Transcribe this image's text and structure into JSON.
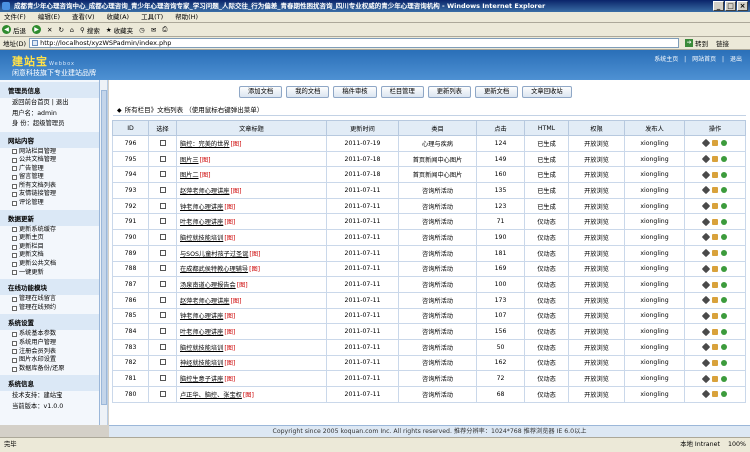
{
  "window": {
    "title": "成都青少年心理咨询中心_成都心理咨询_青少年心理咨询专家_学习问题_人际交往_行为偏差_青春期性困扰咨询_四川专业权威的青少年心理咨询机构 - Windows Internet Explorer"
  },
  "menu": [
    "文件(F)",
    "编辑(E)",
    "查看(V)",
    "收藏(A)",
    "工具(T)",
    "帮助(H)"
  ],
  "toolbar": {
    "back": "后退",
    "search": "搜索",
    "favorites": "收藏夹"
  },
  "address": {
    "label": "地址(D)",
    "url": "http://localhost/xyzWSPadmin/index.php",
    "go": "转到",
    "links": "链接"
  },
  "header": {
    "logo": "建站宝",
    "logo_sub": "Webbox",
    "slogan": "闲意科技旗下专业建站品牌",
    "links": [
      "系统主页",
      "|",
      "网站首页",
      "|",
      "退出"
    ]
  },
  "sidebar": {
    "sections": [
      {
        "title": "管理员信息",
        "text": [
          "返回前台首页 | 退出",
          "用户名：admin",
          "身  份：超级管理员"
        ]
      },
      {
        "title": "网站内容",
        "items": [
          "网站栏目管理",
          "公共文档管理",
          "广告管理",
          "留言管理",
          "所有文档列表",
          "友情链接管理",
          "评论管理"
        ]
      },
      {
        "title": "数据更新",
        "items": [
          "更新系统缓存",
          "更新主页",
          "更新栏目",
          "更新文档",
          "更新公共文档",
          "一键更新"
        ]
      },
      {
        "title": "在线功能模块",
        "items": [
          "管理在线留言",
          "管理在线预约"
        ]
      },
      {
        "title": "系统设置",
        "items": [
          "系统基本参数",
          "系统用户管理",
          "注册会员列表",
          "图片水印设置",
          "数据库备份/还原"
        ]
      },
      {
        "title": "系统信息",
        "text": [
          "技术支持：建站宝",
          "当前版本：v1.0.0"
        ]
      }
    ]
  },
  "tabs": [
    "添加文档",
    "我的文档",
    "稿件审核",
    "栏目管理",
    "更新列表",
    "更新文档",
    "文章回收站"
  ],
  "crumb": "所有栏目》文档列表  （使用鼠标右键弹出菜单）",
  "table": {
    "headers": [
      "ID",
      "选择",
      "文章标题",
      "更新时间",
      "类目",
      "点击",
      "HTML",
      "权限",
      "发布人",
      "操作"
    ],
    "rows": [
      {
        "id": "796",
        "title": "脑控：完美的世界",
        "tag": "[图]",
        "date": "2011-07-19",
        "cat": "心理与疾病",
        "clicks": "124",
        "html": "已生成",
        "perm": "开放浏览",
        "author": "xiongling"
      },
      {
        "id": "795",
        "title": "图片三",
        "tag": "[图]",
        "date": "2011-07-18",
        "cat": "首页新闻中心图片",
        "clicks": "149",
        "html": "已生成",
        "perm": "开放浏览",
        "author": "xiongling"
      },
      {
        "id": "794",
        "title": "图片二",
        "tag": "[图]",
        "date": "2011-07-18",
        "cat": "首页新闻中心图片",
        "clicks": "160",
        "html": "已生成",
        "perm": "开放浏览",
        "author": "xiongling"
      },
      {
        "id": "793",
        "title": "赵萍老师心理讲座",
        "tag": "[图]",
        "date": "2011-07-11",
        "cat": "咨询所活动",
        "clicks": "135",
        "html": "已生成",
        "perm": "开放浏览",
        "author": "xiongling"
      },
      {
        "id": "792",
        "title": "钟老师心理讲座",
        "tag": "[图]",
        "date": "2011-07-11",
        "cat": "咨询所活动",
        "clicks": "123",
        "html": "已生成",
        "perm": "开放浏览",
        "author": "xiongling"
      },
      {
        "id": "791",
        "title": "叶老师心理讲座",
        "tag": "[图]",
        "date": "2011-07-11",
        "cat": "咨询所活动",
        "clicks": "71",
        "html": "仅动态",
        "perm": "开放浏览",
        "author": "xiongling"
      },
      {
        "id": "790",
        "title": "脑控就技能培训",
        "tag": "[图]",
        "date": "2011-07-11",
        "cat": "咨询所活动",
        "clicks": "190",
        "html": "仅动态",
        "perm": "开放浏览",
        "author": "xiongling"
      },
      {
        "id": "789",
        "title": "与SOS儿童村孩子过圣诞",
        "tag": "[图]",
        "date": "2011-07-11",
        "cat": "咨询所活动",
        "clicks": "181",
        "html": "仅动态",
        "perm": "开放浏览",
        "author": "xiongling"
      },
      {
        "id": "788",
        "title": "在成都武侯特教心理辅导",
        "tag": "[图]",
        "date": "2011-07-11",
        "cat": "咨询所活动",
        "clicks": "169",
        "html": "仅动态",
        "perm": "开放浏览",
        "author": "xiongling"
      },
      {
        "id": "787",
        "title": "汤泉南道心理报告会",
        "tag": "[图]",
        "date": "2011-07-11",
        "cat": "咨询所活动",
        "clicks": "100",
        "html": "仅动态",
        "perm": "开放浏览",
        "author": "xiongling"
      },
      {
        "id": "786",
        "title": "赵萍老师心理讲座",
        "tag": "[图]",
        "date": "2011-07-11",
        "cat": "咨询所活动",
        "clicks": "173",
        "html": "仅动态",
        "perm": "开放浏览",
        "author": "xiongling"
      },
      {
        "id": "785",
        "title": "钟老师心理讲座",
        "tag": "[图]",
        "date": "2011-07-11",
        "cat": "咨询所活动",
        "clicks": "107",
        "html": "仅动态",
        "perm": "开放浏览",
        "author": "xiongling"
      },
      {
        "id": "784",
        "title": "叶老师心理讲座",
        "tag": "[图]",
        "date": "2011-07-11",
        "cat": "咨询所活动",
        "clicks": "156",
        "html": "仅动态",
        "perm": "开放浏览",
        "author": "xiongling"
      },
      {
        "id": "783",
        "title": "脑控就技能培训",
        "tag": "[图]",
        "date": "2011-07-11",
        "cat": "咨询所活动",
        "clicks": "50",
        "html": "仅动态",
        "perm": "开放浏览",
        "author": "xiongling"
      },
      {
        "id": "782",
        "title": "神经就技能培训",
        "tag": "[图]",
        "date": "2011-07-11",
        "cat": "咨询所活动",
        "clicks": "162",
        "html": "仅动态",
        "perm": "开放浏览",
        "author": "xiongling"
      },
      {
        "id": "781",
        "title": "脑控生意子讲座",
        "tag": "[图]",
        "date": "2011-07-11",
        "cat": "咨询所活动",
        "clicks": "72",
        "html": "仅动态",
        "perm": "开放浏览",
        "author": "xiongling"
      },
      {
        "id": "780",
        "title": "卢正华、脑控、张宝权",
        "tag": "[图]",
        "date": "2011-07-11",
        "cat": "咨询所活动",
        "clicks": "68",
        "html": "仅动态",
        "perm": "开放浏览",
        "author": "xiongling"
      }
    ]
  },
  "footer": "Copyright since 2005 koquan.com Inc. All rights reserved. 推荐分辨率：1024*768 推荐浏览器 IE 6.0以上",
  "status": {
    "text": "完毕",
    "zone": "本地 Intranet",
    "zoom": "100%"
  }
}
